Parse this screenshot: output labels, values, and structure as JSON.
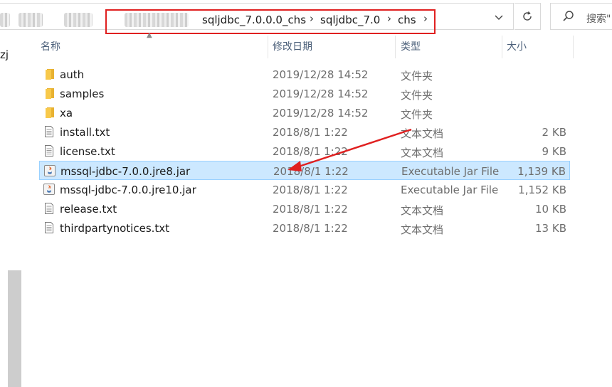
{
  "address_bar": {
    "path": [
      "sqljdbc_7.0.0.0_chs",
      "sqljdbc_7.0",
      "chs"
    ],
    "highlight_color": "#e02020"
  },
  "search": {
    "placeholder": "搜索\""
  },
  "nav": {
    "partial_text": "zj"
  },
  "columns": {
    "name": "名称",
    "date": "修改日期",
    "type": "类型",
    "size": "大小"
  },
  "files": [
    {
      "icon": "folder-icon",
      "name": "auth",
      "date": "2019/12/28 14:52",
      "type": "文件夹",
      "size": ""
    },
    {
      "icon": "folder-icon",
      "name": "samples",
      "date": "2019/12/28 14:52",
      "type": "文件夹",
      "size": ""
    },
    {
      "icon": "folder-icon",
      "name": "xa",
      "date": "2019/12/28 14:52",
      "type": "文件夹",
      "size": ""
    },
    {
      "icon": "text-file-icon",
      "name": "install.txt",
      "date": "2018/8/1 1:22",
      "type": "文本文档",
      "size": "2 KB"
    },
    {
      "icon": "text-file-icon",
      "name": "license.txt",
      "date": "2018/8/1 1:22",
      "type": "文本文档",
      "size": "9 KB"
    },
    {
      "icon": "jar-file-icon",
      "name": "mssql-jdbc-7.0.0.jre8.jar",
      "date": "2018/8/1 1:22",
      "type": "Executable Jar File",
      "size": "1,139 KB",
      "selected": true
    },
    {
      "icon": "jar-file-icon",
      "name": "mssql-jdbc-7.0.0.jre10.jar",
      "date": "2018/8/1 1:22",
      "type": "Executable Jar File",
      "size": "1,152 KB"
    },
    {
      "icon": "text-file-icon",
      "name": "release.txt",
      "date": "2018/8/1 1:22",
      "type": "文本文档",
      "size": "10 KB"
    },
    {
      "icon": "text-file-icon",
      "name": "thirdpartynotices.txt",
      "date": "2018/8/1 1:22",
      "type": "文本文档",
      "size": "13 KB"
    }
  ],
  "colors": {
    "selection": "#cce8ff",
    "annotation": "#e02020",
    "folder": "#f8c94a"
  }
}
